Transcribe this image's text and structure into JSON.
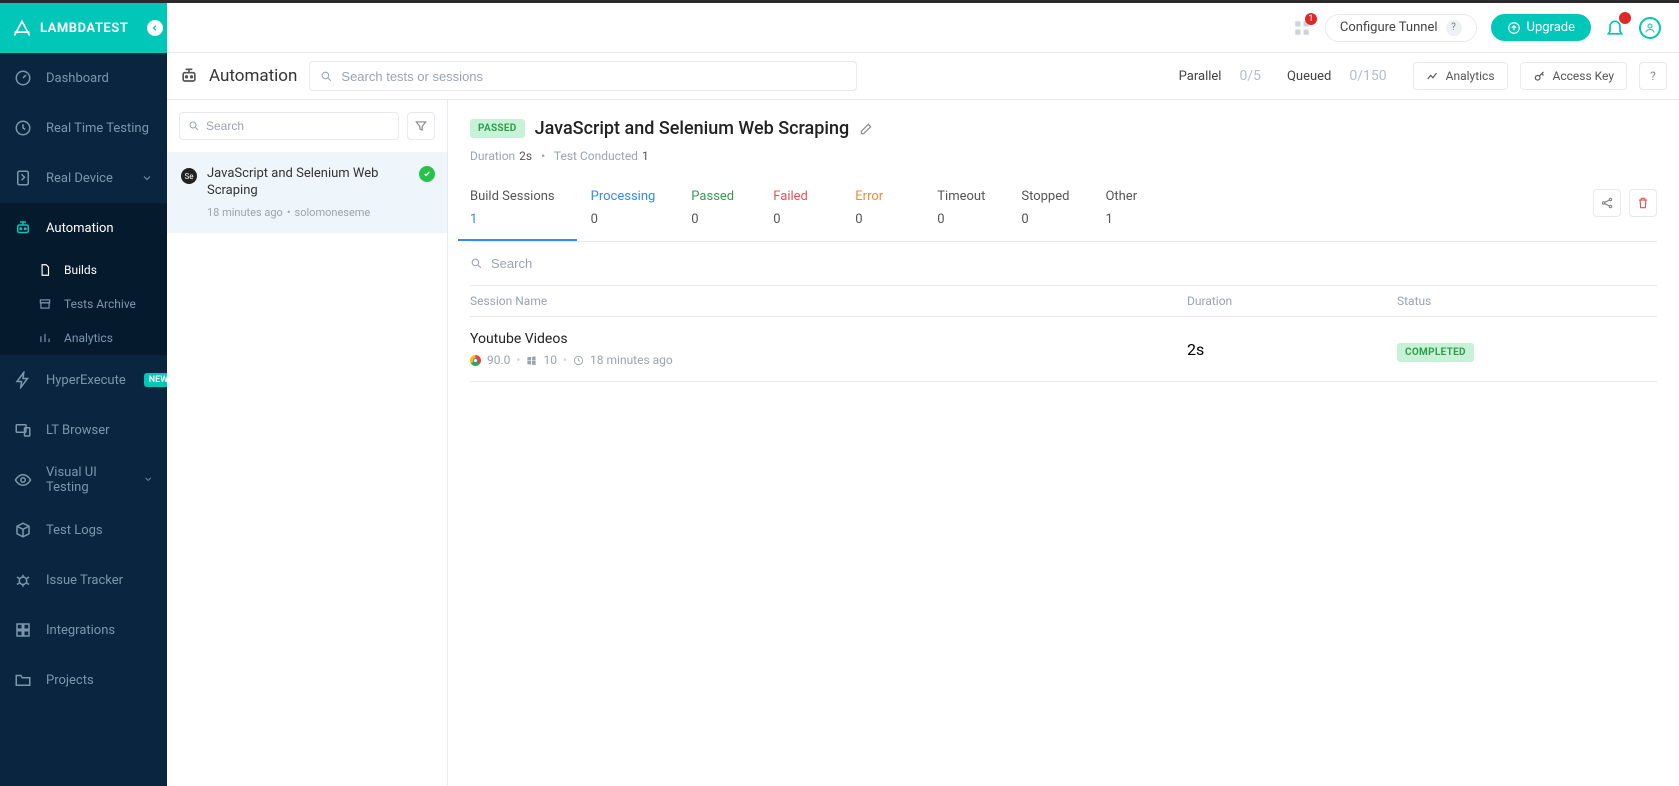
{
  "brand": {
    "name": "LAMBDATEST"
  },
  "sidebar": {
    "items": [
      {
        "label": "Dashboard"
      },
      {
        "label": "Real Time Testing"
      },
      {
        "label": "Real Device"
      },
      {
        "label": "Automation"
      },
      {
        "label": "HyperExecute",
        "badge": "NEW"
      },
      {
        "label": "LT Browser"
      },
      {
        "label": "Visual UI Testing"
      },
      {
        "label": "Test Logs"
      },
      {
        "label": "Issue Tracker"
      },
      {
        "label": "Integrations"
      },
      {
        "label": "Projects"
      }
    ],
    "automation_sub": [
      {
        "label": "Builds"
      },
      {
        "label": "Tests Archive"
      },
      {
        "label": "Analytics"
      }
    ]
  },
  "topbar": {
    "grid_notif": "1",
    "configure_tunnel": "Configure Tunnel",
    "configure_q": "?",
    "upgrade": "Upgrade",
    "bell_notif": ""
  },
  "subheader": {
    "title": "Automation",
    "search_ph": "Search tests or sessions",
    "parallel_label": "Parallel",
    "parallel_val": "0/5",
    "queued_label": "Queued",
    "queued_val": "0/150",
    "analytics_btn": "Analytics",
    "access_key_btn": "Access Key",
    "help_q": "?"
  },
  "builds_pane": {
    "search_ph": "Search",
    "items": [
      {
        "title": "JavaScript and Selenium Web Scraping",
        "time": "18 minutes ago",
        "user": "solomoneseme",
        "icon_text": "Se"
      }
    ]
  },
  "detail": {
    "status_badge": "PASSED",
    "title": "JavaScript and Selenium Web Scraping",
    "duration_label": "Duration",
    "duration_val": "2s",
    "conducted_label": "Test Conducted",
    "conducted_val": "1",
    "stats": [
      {
        "label": "Build Sessions",
        "val": "1"
      },
      {
        "label": "Processing",
        "val": "0"
      },
      {
        "label": "Passed",
        "val": "0"
      },
      {
        "label": "Failed",
        "val": "0"
      },
      {
        "label": "Error",
        "val": "0"
      },
      {
        "label": "Timeout",
        "val": "0"
      },
      {
        "label": "Stopped",
        "val": "0"
      },
      {
        "label": "Other",
        "val": "1"
      }
    ],
    "session_search_ph": "Search",
    "cols": {
      "name": "Session Name",
      "duration": "Duration",
      "status": "Status"
    },
    "sessions": [
      {
        "name": "Youtube Videos",
        "browser_ver": "90.0",
        "os": "10",
        "time": "18 minutes ago",
        "duration": "2s",
        "status": "COMPLETED"
      }
    ]
  }
}
